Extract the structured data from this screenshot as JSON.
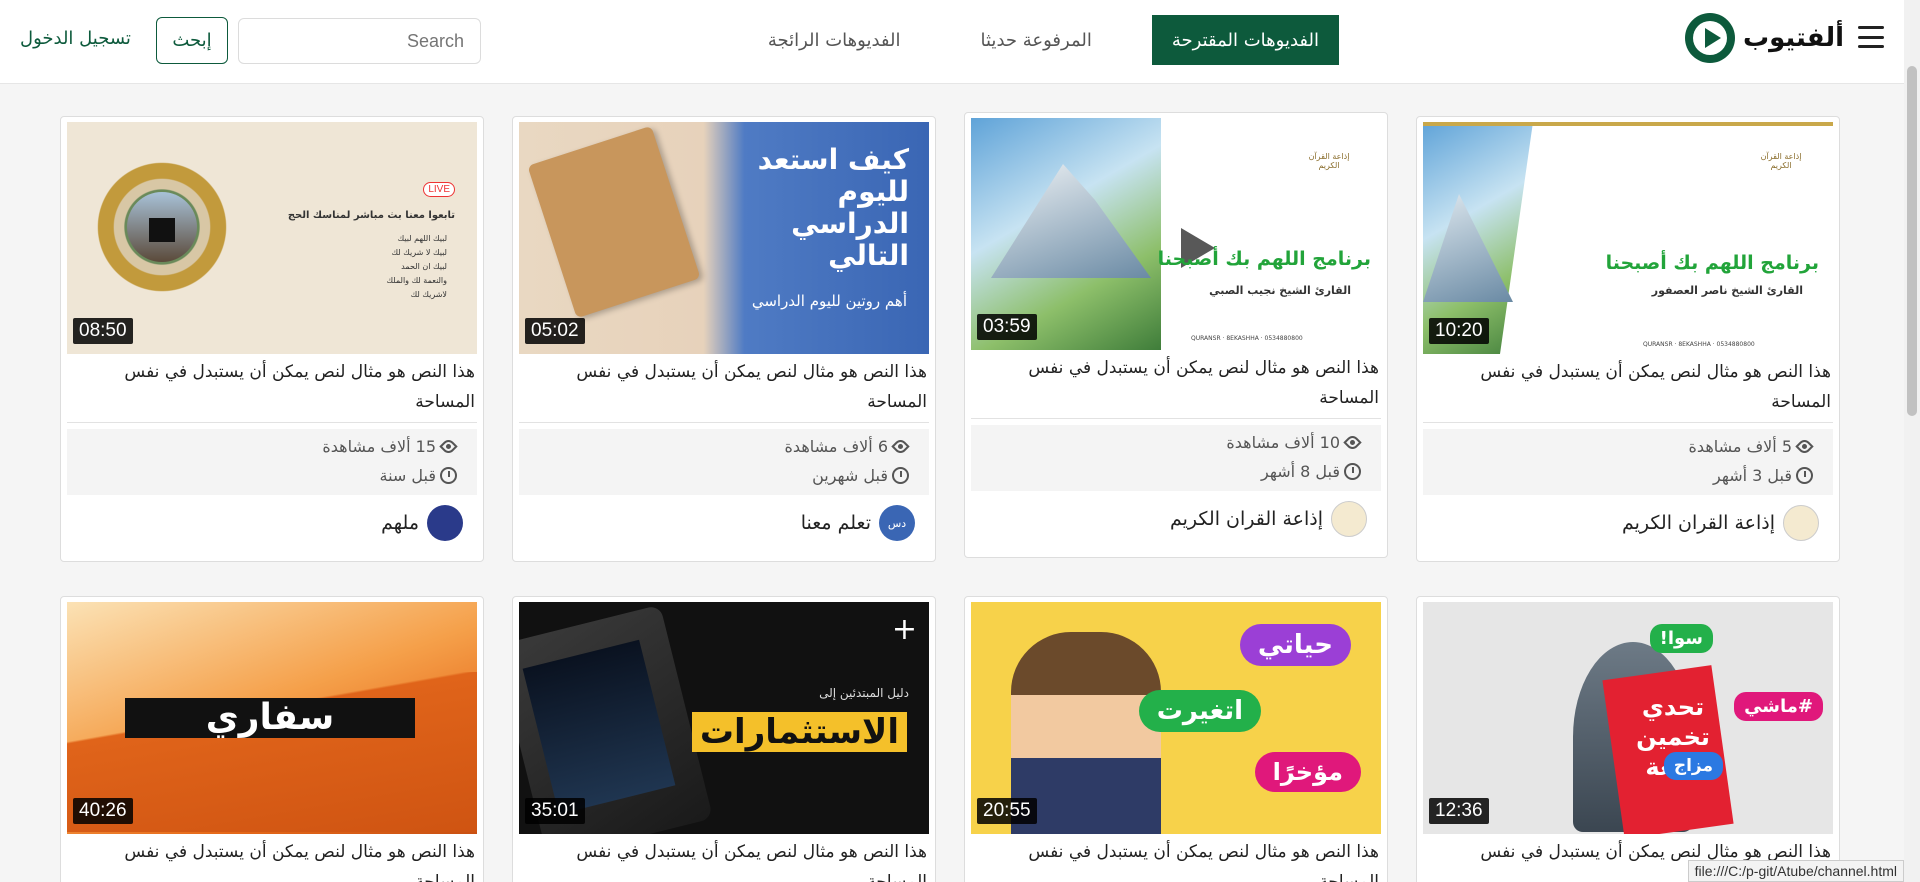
{
  "header": {
    "logo_text": "ألفتيوب",
    "tabs": [
      {
        "label": "الفديوهات المقترحة",
        "active": true
      },
      {
        "label": "المرفوعة حديثا",
        "active": false
      },
      {
        "label": "الفديوهات الرائجة",
        "active": false
      }
    ],
    "search_placeholder": "Search",
    "search_button": "إبحث",
    "login": "تسجيل الدخول"
  },
  "colors": {
    "brand": "#0d5a3c"
  },
  "videos": [
    {
      "duration": "10:20",
      "title": "هذا النص هو مثال لنص يمكن أن يستبدل في نفس المساحة",
      "views": "5 ألاف مشاهدة",
      "ago": "قبل 3 أشهر",
      "channel": "إذاعة القران الكريم",
      "thumb_text": "برنامج اللهم بك أصبحنا",
      "thumb_sub": "القارئ الشيخ ناصر العصفور",
      "thumb_brand": "إذاعة القرآن الكريم",
      "thumb_handles": "QURANSR · 8EKASHHA · 0534880800",
      "thumb_time": "6:30"
    },
    {
      "duration": "03:59",
      "title": "هذا النص هو مثال لنص يمكن أن يستبدل في نفس المساحة",
      "views": "10 ألاف مشاهدة",
      "ago": "قبل 8 أشهر",
      "channel": "إذاعة القران الكريم",
      "thumb_text": "برنامج اللهم بك أصبحنا",
      "thumb_sub": "القارئ الشيخ نجيب الصبي",
      "thumb_brand": "إذاعة القرآن الكريم",
      "thumb_handles": "QURANSR · 8EKASHHA · 0534880800",
      "thumb_time": "6:30"
    },
    {
      "duration": "05:02",
      "title": "هذا النص هو مثال لنص يمكن أن يستبدل في نفس المساحة",
      "views": "6 ألاف مشاهدة",
      "ago": "قبل شهرين",
      "channel": "تعلم معنا",
      "thumb_text": "كيف استعد لليوم الدراسي التالي",
      "thumb_sub": "أهم روتين لليوم الدراسي",
      "thumb_brand": "دس"
    },
    {
      "duration": "08:50",
      "title": "هذا النص هو مثال لنص يمكن أن يستبدل في نفس المساحة",
      "views": "15 ألاف مشاهدة",
      "ago": "قبل سنة",
      "channel": "ملهم",
      "thumb_text": "تابعوا معنا بث مباشر لمناسك الحج",
      "thumb_live": "LIVE",
      "thumb_lines": [
        "لبيك اللهم لبيك",
        "لبيك لا شريك لك",
        "لبيك ان الحمد",
        "والنعمة لك والملك",
        "لاشريك لك"
      ]
    },
    {
      "duration": "12:36",
      "title": "هذا النص هو مثال لنص يمكن أن يستبدل في نفس المساحة",
      "thumb_text": "تحدي تخمين اللغة",
      "thumb_tags": [
        "سوا!",
        "#ماشي",
        "مزاج"
      ]
    },
    {
      "duration": "20:55",
      "title": "هذا النص هو مثال لنص يمكن أن يستبدل في نفس المساحة",
      "thumb_tags": [
        "حياتي",
        "اتغيرت",
        "مؤخرًا"
      ]
    },
    {
      "duration": "35:01",
      "title": "هذا النص هو مثال لنص يمكن أن يستبدل في نفس المساحة",
      "thumb_text": "الاستثمارات",
      "thumb_sub": "دليل المبتدئين إلى"
    },
    {
      "duration": "40:26",
      "title": "هذا النص هو مثال لنص يمكن أن يستبدل في نفس المساحة",
      "thumb_text": "سفاري"
    }
  ],
  "status_url": "file:///C:/p-git/Atube/channel.html"
}
